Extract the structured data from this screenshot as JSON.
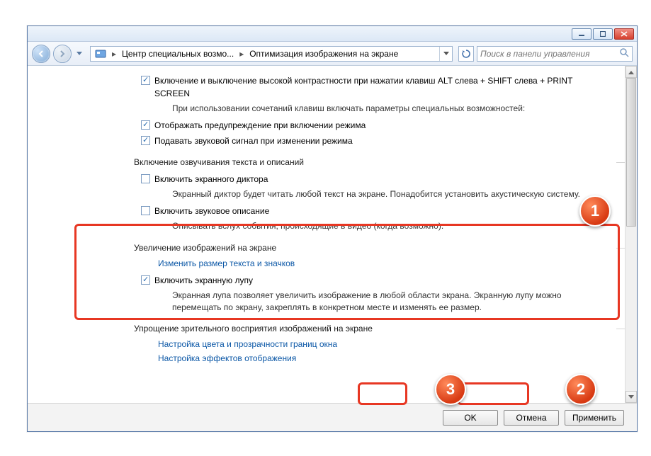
{
  "breadcrumb": {
    "parent": "Центр специальных возмо...",
    "current": "Оптимизация изображения на экране"
  },
  "search": {
    "placeholder": "Поиск в панели управления"
  },
  "top": {
    "contrast_toggle": "Включение и выключение высокой контрастности при нажатии клавиш ALT слева + SHIFT слева + PRINT SCREEN",
    "sub_note": "При использовании сочетаний клавиш включать параметры специальных возможностей:",
    "warning_cb": "Отображать предупреждение при включении режима",
    "sound_cb": "Подавать звуковой сигнал при изменении режима"
  },
  "narration": {
    "title": "Включение озвучивания текста и описаний",
    "narrator_cb": "Включить экранного диктора",
    "narrator_desc": "Экранный диктор будет читать любой текст на экране. Понадобится установить акустическую систему.",
    "audio_cb": "Включить звуковое описание",
    "audio_desc": "Описывать вслух события, происходящие в видео (когда возможно)."
  },
  "magnify": {
    "title": "Увеличение изображений на экране",
    "resize_link": "Изменить размер текста и значков",
    "magnifier_cb": "Включить экранную лупу",
    "magnifier_desc": "Экранная лупа позволяет увеличить изображение в любой области экрана. Экранную лупу можно перемещать по экрану, закреплять в конкретном месте и изменять ее размер."
  },
  "simplify": {
    "title": "Упрощение зрительного восприятия изображений на экране",
    "color_link": "Настройка цвета и прозрачности границ окна",
    "effects_link": "Настройка эффектов отображения"
  },
  "buttons": {
    "ok": "OK",
    "cancel": "Отмена",
    "apply": "Применить"
  },
  "badges": {
    "one": "1",
    "two": "2",
    "three": "3"
  }
}
